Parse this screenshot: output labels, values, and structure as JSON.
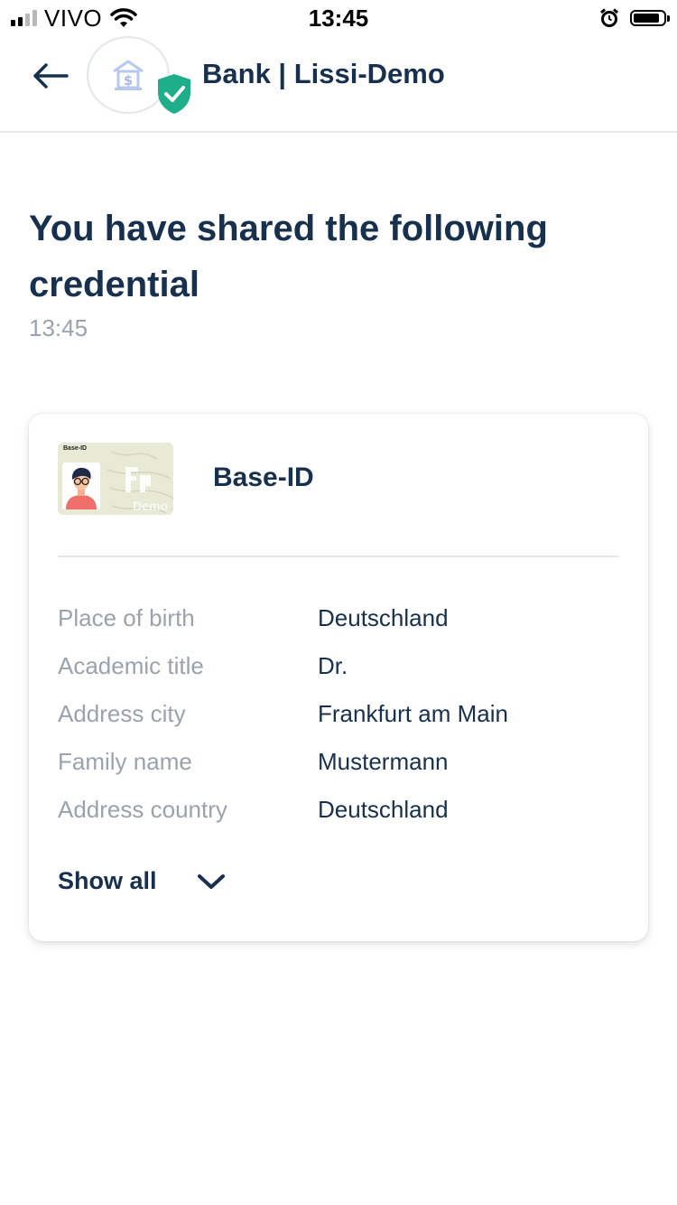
{
  "status_bar": {
    "carrier": "VIVO",
    "time": "13:45"
  },
  "header": {
    "partner_name": "Bank | Lissi-Demo",
    "icons": {
      "back": "arrow-left-icon",
      "partner_logo": "bank-icon",
      "verified": "verified-shield-icon"
    }
  },
  "main": {
    "title": "You have shared the following credential",
    "timestamp": "13:45"
  },
  "credential": {
    "thumbnail_label": "Base-ID",
    "thumbnail_watermark": "Demo",
    "name": "Base-ID",
    "attributes": [
      {
        "label": "Place of birth",
        "value": "Deutschland"
      },
      {
        "label": "Academic title",
        "value": "Dr."
      },
      {
        "label": "Address city",
        "value": "Frankfurt am Main"
      },
      {
        "label": "Family name",
        "value": "Mustermann"
      },
      {
        "label": "Address country",
        "value": "Deutschland"
      }
    ],
    "show_all_label": "Show all"
  },
  "colors": {
    "primary_text": "#17304d",
    "muted_text": "#9aa3ad",
    "verified_green": "#1fae8a"
  }
}
